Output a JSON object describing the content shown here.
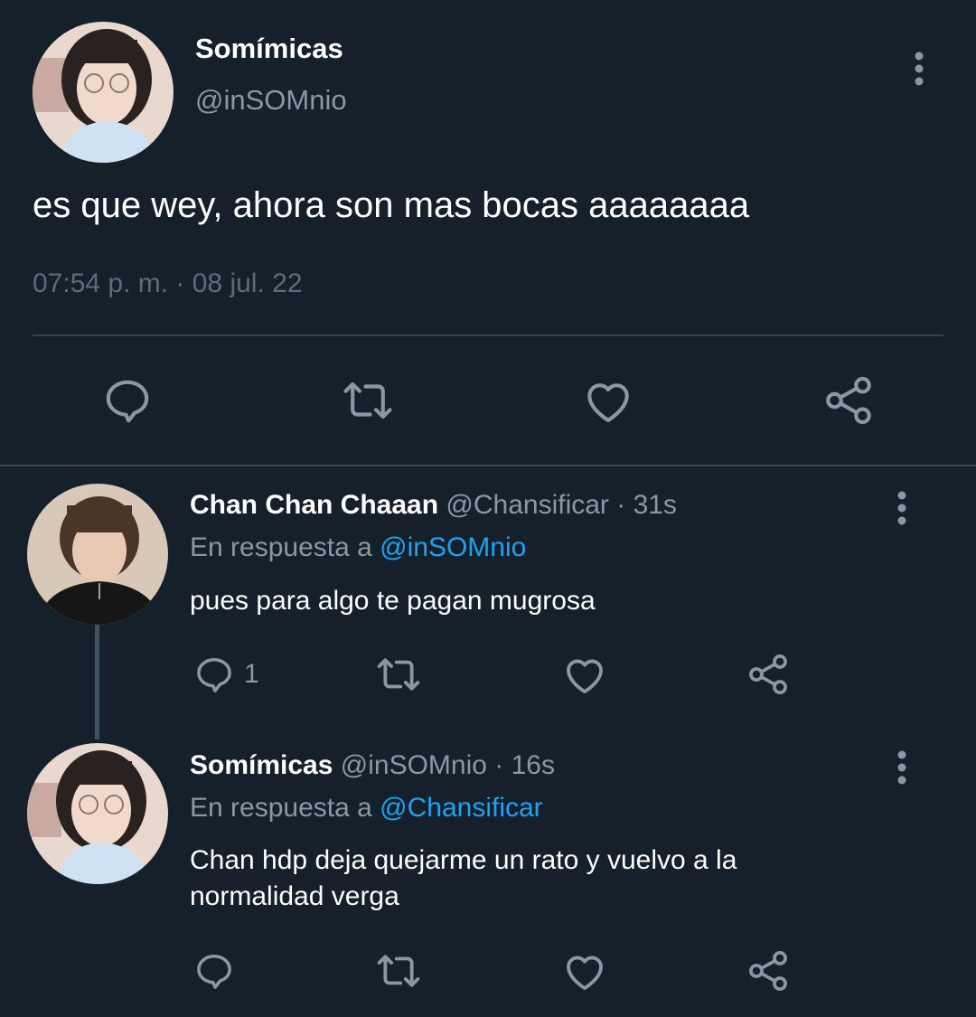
{
  "main_tweet": {
    "display_name": "Somímicas",
    "handle": "@inSOMnio",
    "text": "es que wey, ahora son mas bocas aaaaaaaa",
    "timestamp": "07:54 p. m. · 08 jul. 22",
    "actions": [
      "reply-icon",
      "retweet-icon",
      "like-icon",
      "share-icon"
    ]
  },
  "replies": [
    {
      "display_name": "Chan Chan Chaaan",
      "handle_time": "@Chansificar · 31s",
      "in_reply_prefix": "En respuesta a",
      "in_reply_to": "@inSOMnio",
      "text": "pues para algo te pagan mugrosa",
      "reply_count": "1"
    },
    {
      "display_name": "Somímicas",
      "handle_time": "@inSOMnio · 16s",
      "in_reply_prefix": "En respuesta a",
      "in_reply_to": "@Chansificar",
      "text": "Chan hdp deja quejarme un rato y vuelvo a la normalidad verga",
      "reply_count": ""
    }
  ],
  "colors": {
    "background": "#15202b",
    "primary_text": "#ffffff",
    "secondary_text": "#8899a6",
    "mention": "#1da1f2",
    "divider": "#38444d"
  }
}
